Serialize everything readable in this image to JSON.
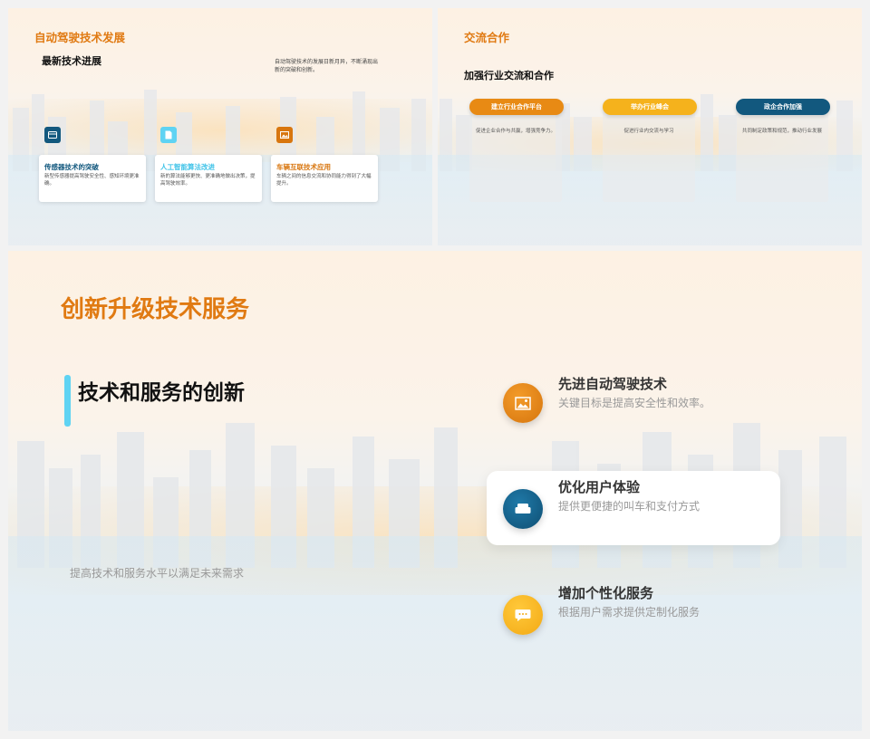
{
  "slide1": {
    "title": "自动驾驶技术发展",
    "subtitle": "最新技术进展",
    "intro": "自动驾驶技术的发展日新月异，不断涌现出新的突破和创新。",
    "cards": [
      {
        "title": "传感器技术的突破",
        "desc": "新型传感器提高驾驶安全性、感知环境更准确。",
        "icon": "card-icon",
        "color": "#12587e"
      },
      {
        "title": "人工智能算法改进",
        "desc": "新的算法能够更快、更准确地做出决策，提高驾驶效率。",
        "icon": "document-icon",
        "color": "#5fd3f3"
      },
      {
        "title": "车辆互联技术应用",
        "desc": "车辆之间的信息交流和协同能力得到了大幅提升。",
        "icon": "image-icon",
        "color": "#d8760f"
      }
    ]
  },
  "slide2": {
    "title": "交流合作",
    "subtitle": "加强行业交流和合作",
    "columns": [
      {
        "label": "建立行业合作平台",
        "desc": "促进企业合作与共赢，增强竞争力。",
        "color": "#e88a14"
      },
      {
        "label": "举办行业峰会",
        "desc": "促进行业内交流与学习",
        "color": "#f5b21c"
      },
      {
        "label": "政企合作加强",
        "desc": "共同制定政策和规范，推动行业发展",
        "color": "#12587e"
      }
    ]
  },
  "slide3": {
    "title": "创新升级技术服务",
    "subtitle": "技术和服务的创新",
    "footnote": "提高技术和服务水平以满足未来需求",
    "features": [
      {
        "title": "先进自动驾驶技术",
        "desc": "关键目标是提高安全性和效率。",
        "icon": "image-icon",
        "color": "#e0820f"
      },
      {
        "title": "优化用户体验",
        "desc": "提供更便捷的叫车和支付方式",
        "icon": "sofa-icon",
        "color": "#12587e"
      },
      {
        "title": "增加个性化服务",
        "desc": "根据用户需求提供定制化服务",
        "icon": "chat-icon",
        "color": "#f5b21c"
      }
    ],
    "accent": "#5fd3f3"
  }
}
